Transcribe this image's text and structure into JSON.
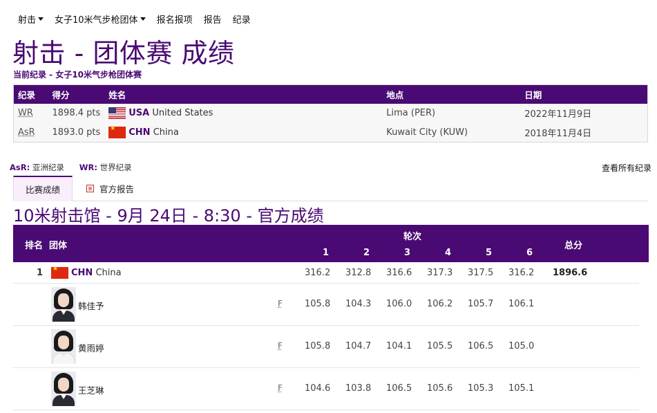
{
  "nav": {
    "items": [
      {
        "label": "射击",
        "dropdown": true
      },
      {
        "label": "女子10米气步枪团体",
        "dropdown": true
      },
      {
        "label": "报名报项",
        "dropdown": false
      },
      {
        "label": "报告",
        "dropdown": false
      },
      {
        "label": "纪录",
        "dropdown": false
      }
    ]
  },
  "page": {
    "title": "射击 - 团体赛 成绩",
    "subtitle": "当前纪录 - 女子10米气步枪团体赛"
  },
  "records": {
    "headers": [
      "纪录",
      "得分",
      "姓名",
      "地点",
      "日期"
    ],
    "rows": [
      {
        "type": "WR",
        "score": "1898.4 pts",
        "noc": "USA",
        "country": "United States",
        "place": "Lima (PER)",
        "date": "2022年11月9日",
        "flag": "usa"
      },
      {
        "type": "AsR",
        "score": "1893.0 pts",
        "noc": "CHN",
        "country": "China",
        "place": "Kuwait City (KUW)",
        "date": "2018年11月4日",
        "flag": "chn"
      }
    ]
  },
  "legend": {
    "asr_abbr": "AsR:",
    "asr_text": "亚洲纪录",
    "wr_abbr": "WR:",
    "wr_text": "世界纪录",
    "view_all": "查看所有纪录"
  },
  "tabs": {
    "results": "比赛成绩",
    "official_report": "官方报告"
  },
  "section": {
    "title": "10米射击馆 - 9月 24日 - 8:30 - 官方成绩"
  },
  "results": {
    "headers": {
      "rank": "排名",
      "team": "团体",
      "rounds": "轮次",
      "round_numbers": [
        "1",
        "2",
        "3",
        "4",
        "5",
        "6"
      ],
      "total": "总分"
    },
    "team": {
      "rank": "1",
      "noc": "CHN",
      "country": "China",
      "scores": [
        "316.2",
        "312.8",
        "316.6",
        "317.3",
        "317.5",
        "316.2"
      ],
      "total": "1896.6"
    },
    "athletes": [
      {
        "name": "韩佳予",
        "gender": "F",
        "scores": [
          "105.8",
          "104.3",
          "106.0",
          "106.2",
          "105.7",
          "106.1"
        ],
        "outfit": "dark"
      },
      {
        "name": "黄雨婷",
        "gender": "F",
        "scores": [
          "105.8",
          "104.7",
          "104.1",
          "105.5",
          "106.5",
          "105.0"
        ],
        "outfit": "white"
      },
      {
        "name": "王芝琳",
        "gender": "F",
        "scores": [
          "104.6",
          "103.8",
          "106.5",
          "105.6",
          "105.3",
          "105.1"
        ],
        "outfit": "dark"
      }
    ]
  },
  "colors": {
    "brand": "#4a0a73",
    "header_text": "#ffffff"
  }
}
